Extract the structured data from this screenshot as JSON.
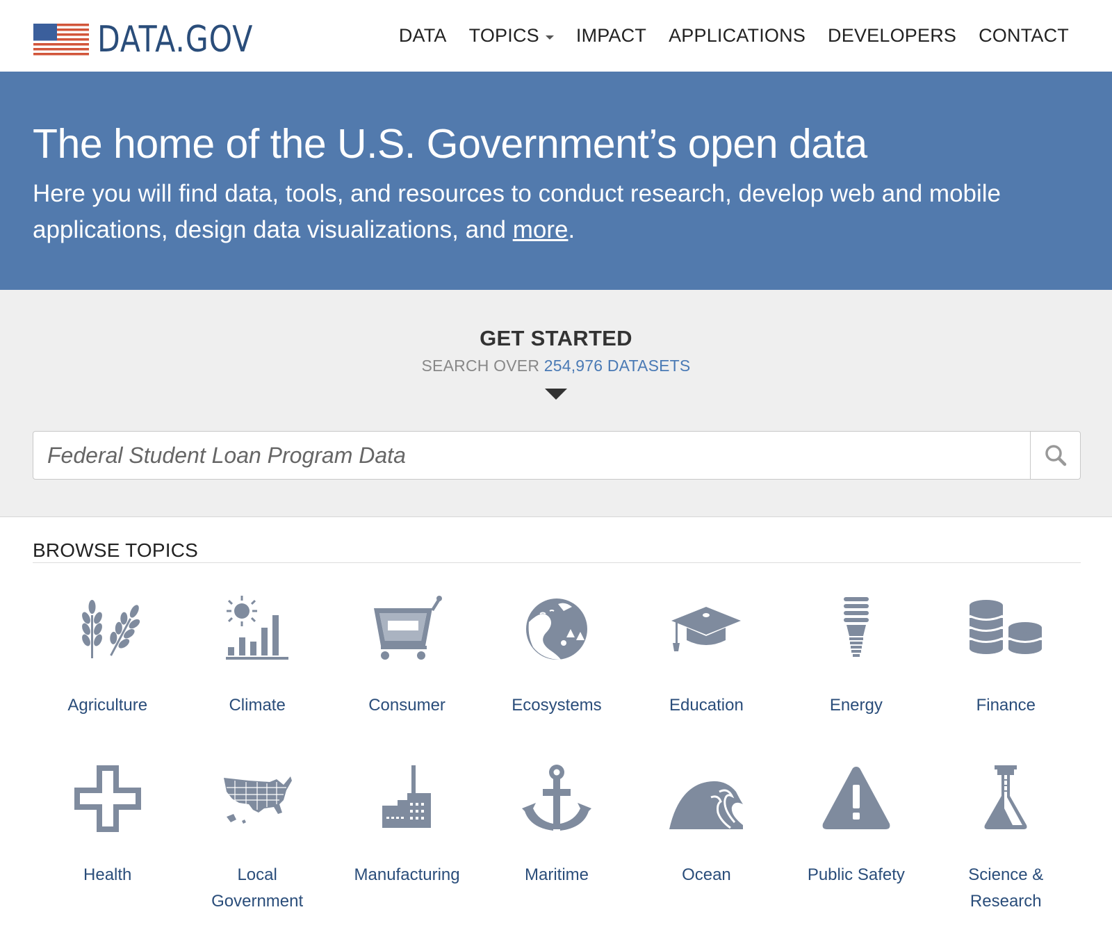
{
  "header": {
    "logo_text": "DATA.GOV",
    "nav": [
      {
        "label": "DATA"
      },
      {
        "label": "TOPICS",
        "has_dropdown": true
      },
      {
        "label": "IMPACT"
      },
      {
        "label": "APPLICATIONS"
      },
      {
        "label": "DEVELOPERS"
      },
      {
        "label": "CONTACT"
      }
    ]
  },
  "hero": {
    "title": "The home of the U.S. Government’s open data",
    "intro_text": "Here you will find data, tools, and resources to conduct research, develop web and mobile applications, design data visualizations, and ",
    "more_link": "more",
    "suffix": "."
  },
  "get_started": {
    "heading": "GET STARTED",
    "sub_prefix": "SEARCH OVER ",
    "dataset_count": "254,976 DATASETS",
    "search_placeholder": "Federal Student Loan Program Data"
  },
  "browse": {
    "heading": "BROWSE TOPICS",
    "topics": [
      {
        "label": "Agriculture",
        "icon": "wheat-icon"
      },
      {
        "label": "Climate",
        "icon": "sun-chart-icon"
      },
      {
        "label": "Consumer",
        "icon": "shopping-cart-icon"
      },
      {
        "label": "Ecosystems",
        "icon": "landscape-icon"
      },
      {
        "label": "Education",
        "icon": "graduation-cap-icon"
      },
      {
        "label": "Energy",
        "icon": "lightbulb-icon"
      },
      {
        "label": "Finance",
        "icon": "coins-icon"
      },
      {
        "label": "Health",
        "icon": "cross-icon"
      },
      {
        "label": "Local\nGovernment",
        "icon": "us-map-icon"
      },
      {
        "label": "Manufacturing",
        "icon": "factory-icon"
      },
      {
        "label": "Maritime",
        "icon": "anchor-icon"
      },
      {
        "label": "Ocean",
        "icon": "wave-icon"
      },
      {
        "label": "Public Safety",
        "icon": "warning-icon"
      },
      {
        "label": "Science &\nResearch",
        "icon": "flask-icon"
      }
    ]
  },
  "colors": {
    "hero_bg": "#527aad",
    "brand_blue": "#2a4d7a",
    "link_blue": "#4a7ab5",
    "icon_gray": "#7f8b9e"
  }
}
